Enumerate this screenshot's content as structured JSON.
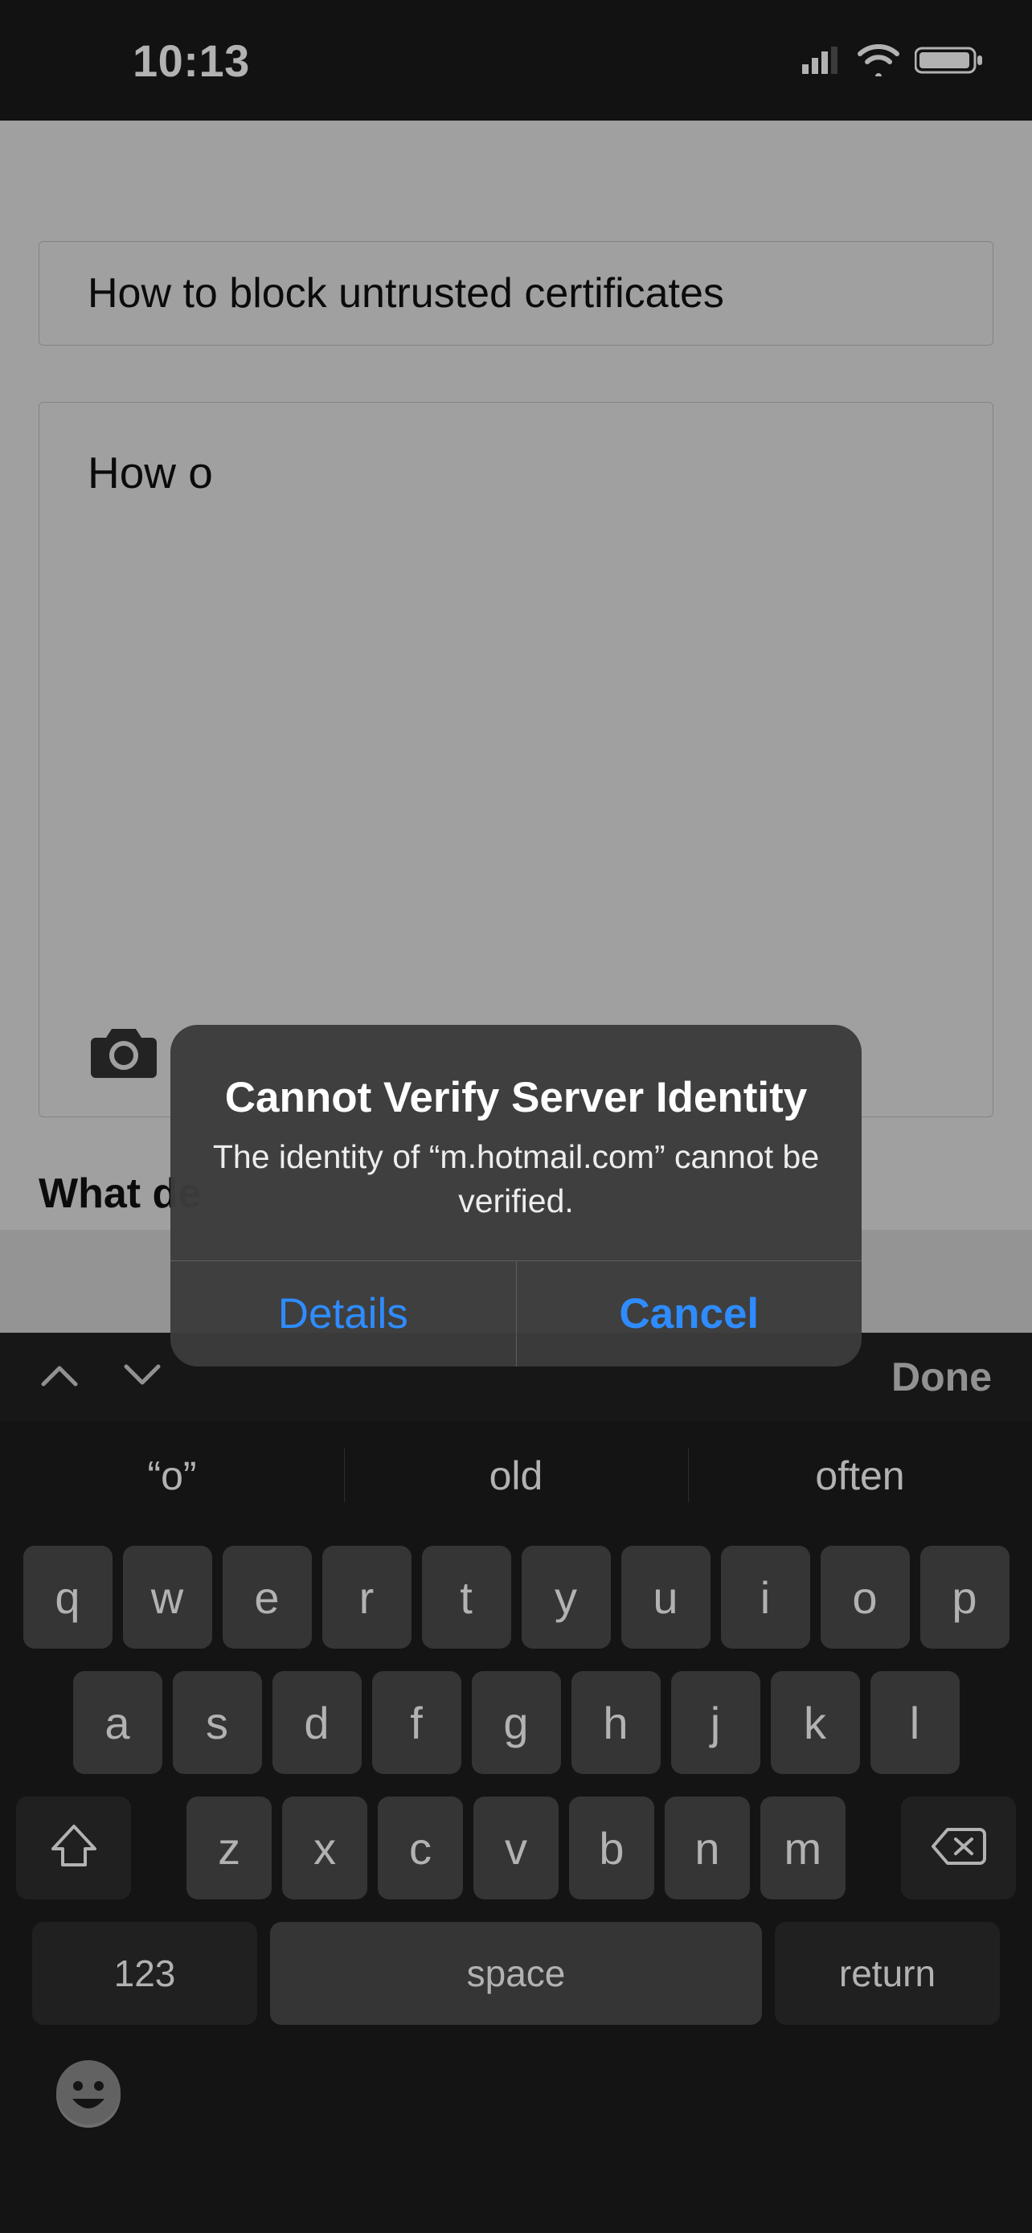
{
  "status": {
    "time": "10:13"
  },
  "form": {
    "title_value": "How to block untrusted certificates",
    "body_value": "How o",
    "section_label": "What de"
  },
  "alert": {
    "title": "Cannot Verify Server Identity",
    "message": "The identity of “m.hotmail.com” cannot be verified.",
    "details_label": "Details",
    "cancel_label": "Cancel"
  },
  "keyboard": {
    "done": "Done",
    "suggestions": [
      "“o”",
      "old",
      "often"
    ],
    "row1": [
      "q",
      "w",
      "e",
      "r",
      "t",
      "y",
      "u",
      "i",
      "o",
      "p"
    ],
    "row2": [
      "a",
      "s",
      "d",
      "f",
      "g",
      "h",
      "j",
      "k",
      "l"
    ],
    "row3": [
      "z",
      "x",
      "c",
      "v",
      "b",
      "n",
      "m"
    ],
    "num_label": "123",
    "space_label": "space",
    "return_label": "return"
  }
}
